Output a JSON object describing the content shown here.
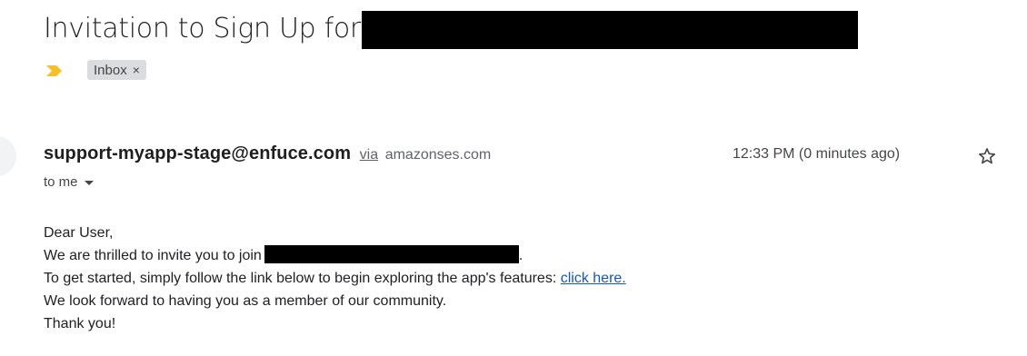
{
  "email": {
    "subject": "Invitation to Sign Up for",
    "labels": [
      {
        "name": "Inbox",
        "close_glyph": "×"
      }
    ],
    "importance_marker": {
      "icon": "importance-marker-icon",
      "color": "#f6c026"
    },
    "sender": {
      "email": "support-myapp-stage@enfuce.com",
      "via_label": "via",
      "via_domain": "amazonses.com"
    },
    "time": "12:33 PM (0 minutes ago)",
    "star_icon": "star-outline-icon",
    "recipient": "to me",
    "body": {
      "greeting": "Dear User,",
      "line1_prefix": "We are thrilled to invite you to join",
      "line1_suffix": ".",
      "line2_prefix": "To get started, simply follow the link below to begin exploring the app's features:",
      "line2_link": "click here.",
      "line3": "We look forward to having you as a member of our community.",
      "closing": "Thank you!"
    },
    "colors": {
      "link": "#1155cc",
      "chip_bg": "#dadce0",
      "text": "#202124",
      "muted": "#444746"
    }
  }
}
